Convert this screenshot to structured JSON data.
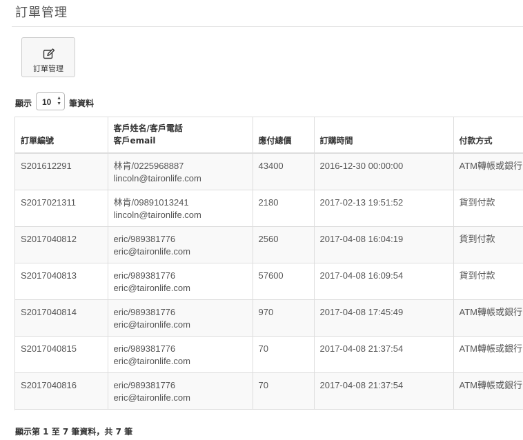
{
  "page": {
    "title": "訂單管理"
  },
  "toolbar": {
    "manage_label": "訂單管理"
  },
  "length": {
    "pre": "顯示",
    "value": "10",
    "post": "筆資料"
  },
  "table": {
    "headers": {
      "order_no": "訂單編號",
      "customer_line1": "客戶姓名/客戶電話",
      "customer_line2": "客戶email",
      "total": "應付總價",
      "time": "訂購時間",
      "payment": "付款方式"
    },
    "rows": [
      {
        "order_no": "S201612291",
        "contact": "林肯/0225968887",
        "email": "lincoln@taironlife.com",
        "total": "43400",
        "time": "2016-12-30 00:00:00",
        "payment": "ATM轉帳或銀行匯款"
      },
      {
        "order_no": "S2017021311",
        "contact": "林肯/09891013241",
        "email": "lincoln@taironlife.com",
        "total": "2180",
        "time": "2017-02-13 19:51:52",
        "payment": "貨到付款"
      },
      {
        "order_no": "S2017040812",
        "contact": "eric/989381776",
        "email": "eric@taironlife.com",
        "total": "2560",
        "time": "2017-04-08 16:04:19",
        "payment": "貨到付款"
      },
      {
        "order_no": "S2017040813",
        "contact": "eric/989381776",
        "email": "eric@taironlife.com",
        "total": "57600",
        "time": "2017-04-08 16:09:54",
        "payment": "貨到付款"
      },
      {
        "order_no": "S2017040814",
        "contact": "eric/989381776",
        "email": "eric@taironlife.com",
        "total": "970",
        "time": "2017-04-08 17:45:49",
        "payment": "ATM轉帳或銀行匯款"
      },
      {
        "order_no": "S2017040815",
        "contact": "eric/989381776",
        "email": "eric@taironlife.com",
        "total": "70",
        "time": "2017-04-08 21:37:54",
        "payment": "ATM轉帳或銀行匯款"
      },
      {
        "order_no": "S2017040816",
        "contact": "eric/989381776",
        "email": "eric@taironlife.com",
        "total": "70",
        "time": "2017-04-08 21:37:54",
        "payment": "ATM轉帳或銀行匯款"
      }
    ]
  },
  "footer": {
    "info": "顯示第 1 至 7 筆資料，共 7 筆"
  },
  "icons": {
    "toolbar_icon": "edit-icon",
    "select_arrows": "sort-arrows-icon"
  }
}
